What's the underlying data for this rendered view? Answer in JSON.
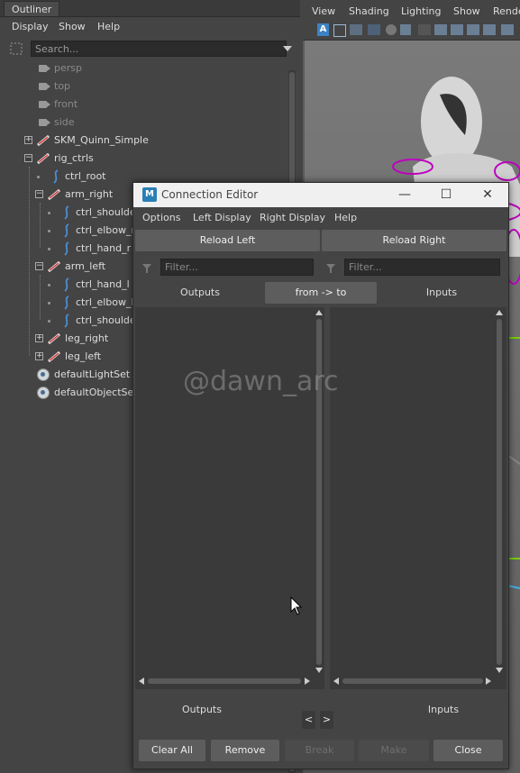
{
  "outliner": {
    "tab": "Outliner",
    "menu": [
      "Display",
      "Show",
      "Help"
    ],
    "search_placeholder": "Search...",
    "items": [
      {
        "label": "persp"
      },
      {
        "label": "top"
      },
      {
        "label": "front"
      },
      {
        "label": "side"
      },
      {
        "label": "SKM_Quinn_Simple"
      },
      {
        "label": "rig_ctrls"
      },
      {
        "label": "ctrl_root"
      },
      {
        "label": "arm_right"
      },
      {
        "label": "ctrl_shoulde"
      },
      {
        "label": "ctrl_elbow_r"
      },
      {
        "label": "ctrl_hand_r"
      },
      {
        "label": "arm_left"
      },
      {
        "label": "ctrl_hand_l"
      },
      {
        "label": "ctrl_elbow_l"
      },
      {
        "label": "ctrl_shoulde"
      },
      {
        "label": "leg_right"
      },
      {
        "label": "leg_left"
      },
      {
        "label": "defaultLightSet"
      },
      {
        "label": "defaultObjectSet"
      }
    ],
    "expander_plus": "+",
    "expander_minus": "−"
  },
  "viewport": {
    "menu": [
      "View",
      "Shading",
      "Lighting",
      "Show",
      "Rende"
    ],
    "toolbar_a": "A"
  },
  "connection_editor": {
    "logo": "M",
    "title": "Connection Editor",
    "minimize": "—",
    "maximize": "☐",
    "close_x": "✕",
    "menu": [
      "Options",
      "Left Display",
      "Right Display",
      "Help"
    ],
    "reload_left": "Reload Left",
    "reload_right": "Reload Right",
    "filter_placeholder": "Filter...",
    "col_outputs": "Outputs",
    "col_mode": "from -> to",
    "col_inputs": "Inputs",
    "bottom_outputs": "Outputs",
    "bottom_inputs": "Inputs",
    "nav_left": "<",
    "nav_right": ">",
    "buttons": {
      "clear_all": "Clear All",
      "remove": "Remove",
      "break": "Break",
      "make": "Make",
      "close": "Close"
    }
  },
  "watermark": "@dawn_arc",
  "colors": {
    "background": "#444444",
    "panel": "#3a3a3a",
    "rig_curve": "#4a8fd6",
    "joint_red": "#d24040",
    "viewport_magenta": "#c000c0"
  }
}
